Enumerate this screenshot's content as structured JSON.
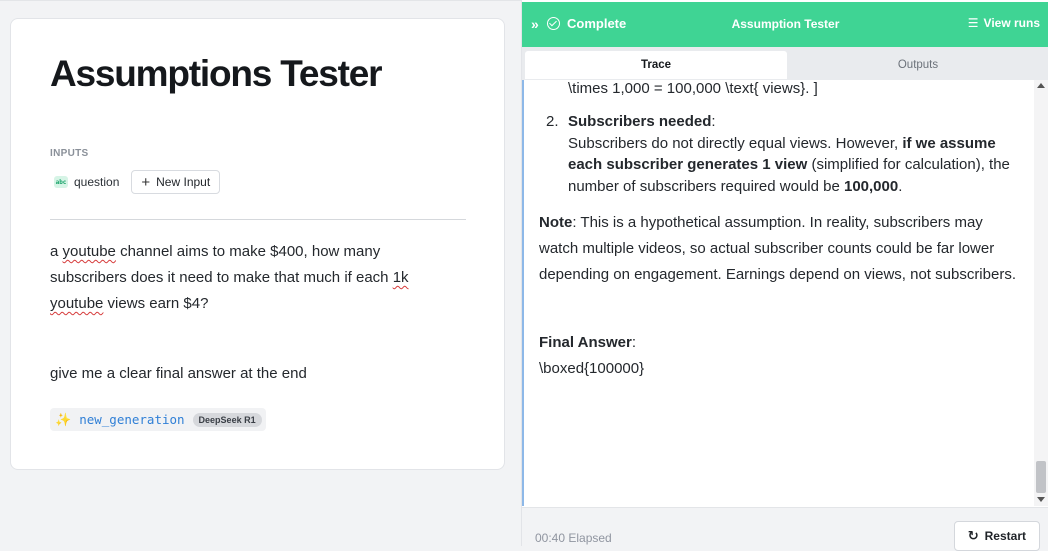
{
  "app": {
    "title": "Assumptions Tester"
  },
  "inputs": {
    "label": "INPUTS",
    "param_icon": "abc-icon",
    "param_icon_text": "abc",
    "param_name": "question",
    "new_input_label": "New Input"
  },
  "question": {
    "p1_a": "a ",
    "p1_w1": "youtube",
    "p1_b": " channel aims to make $400, how many",
    "p1_c": "subscribers does it need to make that much if each ",
    "p1_w2": "1k",
    "p1_w3": "youtube",
    "p1_d": " views earn $4?",
    "p2": "give me a clear final answer at the end"
  },
  "generation": {
    "icon": "sparkle-icon",
    "glyph": "✨",
    "name": "new_generation",
    "model": "DeepSeek R1"
  },
  "run_panel": {
    "collapse_glyph": "»",
    "status": "Complete",
    "status_color": "#3fd494",
    "title": "Assumption Tester",
    "view_runs": "View runs",
    "list_glyph": "☰",
    "tabs": [
      "Trace",
      "Outputs"
    ],
    "active_tab": "Trace"
  },
  "trace": {
    "line_frag": "\\times 1,000 = 100,000 \\text{ views}. ]",
    "item_num": "2.",
    "item_head": "Subscribers needed",
    "item_colon": ":",
    "item_t1": "Subscribers do not directly equal views. However, ",
    "item_b1": "if we assume each subscriber generates 1 view",
    "item_t2": " (simplified for calculation), the number of subscribers required would be ",
    "item_b2": "100,000",
    "item_t3": ".",
    "note_label": "Note",
    "note_text": ": This is a hypothetical assumption. In reality, subscribers may watch multiple videos, so actual subscriber counts could be far lower depending on engagement. Earnings depend on views, not subscribers.",
    "final_label": "Final Answer",
    "final_colon": ":",
    "boxed": "\\boxed{100000}"
  },
  "footer": {
    "elapsed": "00:40 Elapsed",
    "restart_label": "Restart",
    "restart_glyph": "↻"
  }
}
